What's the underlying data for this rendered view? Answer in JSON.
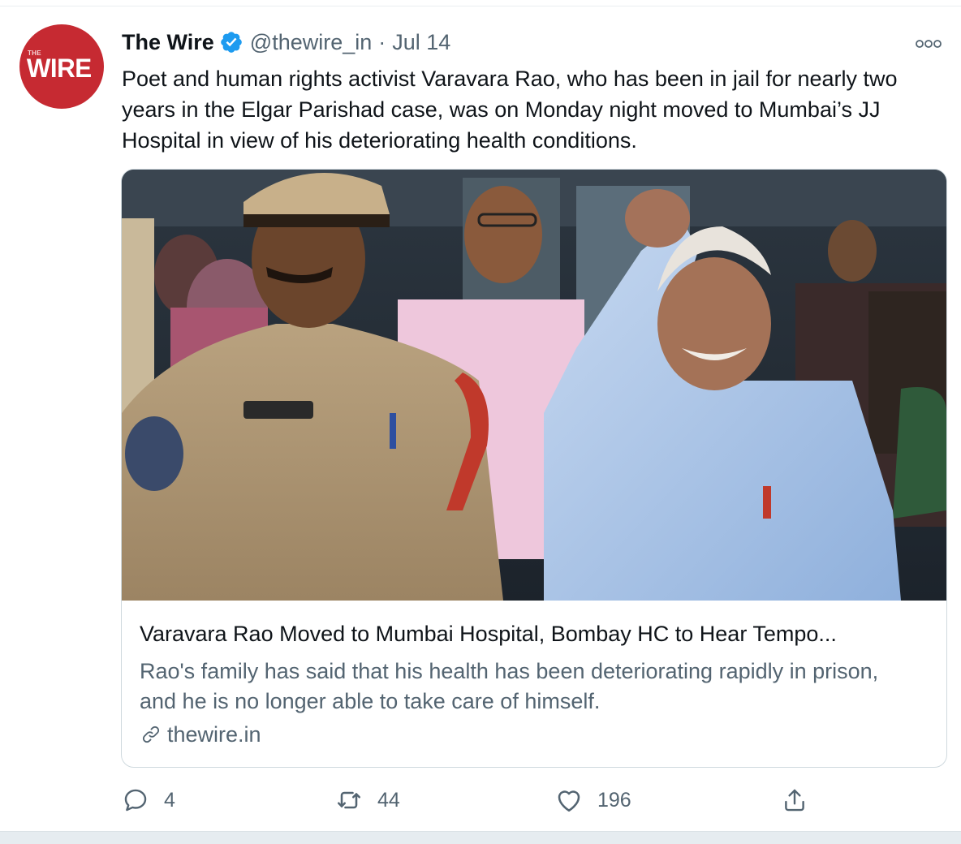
{
  "tweet": {
    "author": {
      "display_name": "The Wire",
      "handle": "@thewire_in",
      "separator": "·",
      "timestamp": "Jul 14",
      "avatar": {
        "small_text": "THE",
        "big_text": "WIRE",
        "color": "#c62a32"
      },
      "verified_icon": "verified-badge-icon"
    },
    "text": "Poet and human rights activist Varavara Rao, who has been in jail for nearly two years in the Elgar Parishad case, was on Monday night moved to Mumbai’s JJ Hospital in view of his deteriorating health conditions.",
    "more_icon": "more-options-icon",
    "card": {
      "image_alt": "Varavara Rao raising fist next to police officer",
      "title": "Varavara Rao Moved to Mumbai Hospital, Bombay HC to Hear Tempo...",
      "description": "Rao's family has said that his health has been deteriorating rapidly in prison, and he is no longer able to take care of himself.",
      "domain": "thewire.in",
      "link_icon": "link-icon"
    },
    "actions": {
      "reply": {
        "icon": "reply-icon",
        "count": "4"
      },
      "retweet": {
        "icon": "retweet-icon",
        "count": "44"
      },
      "like": {
        "icon": "heart-icon",
        "count": "196"
      },
      "share": {
        "icon": "share-icon"
      }
    }
  },
  "colors": {
    "text_primary": "#0f1419",
    "text_secondary": "#536471",
    "verified_blue": "#1d9bf0",
    "border": "#cfd9de"
  }
}
